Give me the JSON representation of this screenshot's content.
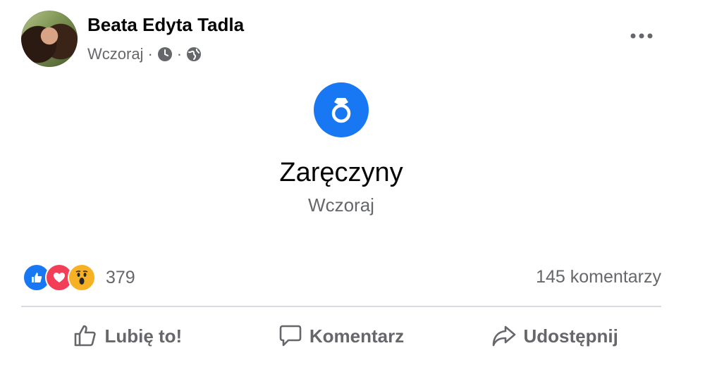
{
  "post": {
    "author": "Beata Edyta Tadla",
    "time": "Wczoraj",
    "separator": "·",
    "event": {
      "title": "Zaręczyny",
      "date": "Wczoraj",
      "icon": "ring-icon"
    },
    "reactions": {
      "types": [
        "like",
        "love",
        "wow"
      ],
      "count": "379"
    },
    "comments_count": "145 komentarzy",
    "actions": {
      "like": "Lubię to!",
      "comment": "Komentarz",
      "share": "Udostępnij"
    }
  },
  "colors": {
    "accent": "#1877f2",
    "love": "#f33e58",
    "wow": "#f7b125",
    "secondary_text": "#65676b"
  }
}
